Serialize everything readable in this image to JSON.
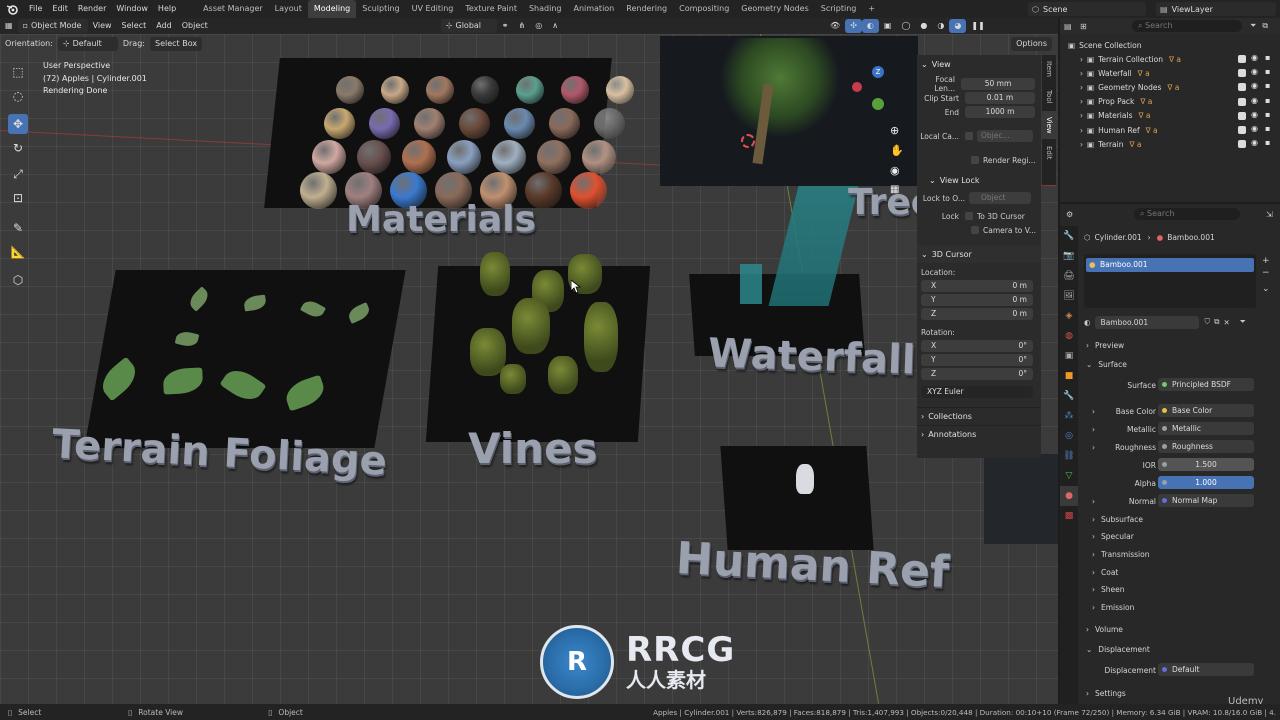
{
  "menu": {
    "items": [
      "File",
      "Edit",
      "Render",
      "Window",
      "Help"
    ],
    "workspaces": [
      "Asset Manager",
      "Layout",
      "Modeling",
      "Sculpting",
      "UV Editing",
      "Texture Paint",
      "Shading",
      "Animation",
      "Rendering",
      "Compositing",
      "Geometry Nodes",
      "Scripting"
    ],
    "active_workspace": "Modeling",
    "add_tab": "+",
    "scene": "Scene",
    "view_layer": "ViewLayer"
  },
  "viewport_header": {
    "mode": "Object Mode",
    "menus": [
      "View",
      "Select",
      "Add",
      "Object"
    ],
    "transform": "Global",
    "options": "Options",
    "orientation_label": "Orientation:",
    "orientation": "Default",
    "drag_label": "Drag:",
    "drag": "Select Box"
  },
  "viewport_info": {
    "perspective": "User Perspective",
    "object": "(72) Apples | Cylinder.001",
    "status": "Rendering Done"
  },
  "viewport_labels": {
    "materials": "Materials",
    "terrain_foliage": "Terrain Foliage",
    "vines": "Vines",
    "waterfall": "Waterfall",
    "human_ref": "Human Ref",
    "trees": "Tree"
  },
  "npanel": {
    "view_header": "View",
    "focal_label": "Focal Len...",
    "focal_value": "50 mm",
    "clip_start_label": "Clip Start",
    "clip_start_value": "0.01 m",
    "clip_end_label": "End",
    "clip_end_value": "1000 m",
    "local_camera_label": "Local Ca...",
    "local_camera_placeholder": "Objec...",
    "render_region": "Render Regi...",
    "view_lock_header": "View Lock",
    "lock_to_object_label": "Lock to O...",
    "lock_to_object_placeholder": "Object",
    "lock_label": "Lock",
    "to_3d_cursor": "To 3D Cursor",
    "camera_to_view": "Camera to V...",
    "cursor_header": "3D Cursor",
    "location_label": "Location:",
    "loc_x_label": "X",
    "loc_x": "0 m",
    "loc_y_label": "Y",
    "loc_y": "0 m",
    "loc_z_label": "Z",
    "loc_z": "0 m",
    "rotation_label": "Rotation:",
    "rot_x_label": "X",
    "rot_x": "0°",
    "rot_y_label": "Y",
    "rot_y": "0°",
    "rot_z_label": "Z",
    "rot_z": "0°",
    "rotation_mode": "XYZ Euler",
    "collections": "Collections",
    "annotations": "Annotations",
    "tabs": [
      "Item",
      "Tool",
      "View",
      "Edit"
    ]
  },
  "outliner": {
    "search_placeholder": "Search",
    "root": "Scene Collection",
    "items": [
      "Terrain Collection",
      "Waterfall",
      "Geometry Nodes",
      "Prop Pack",
      "Materials",
      "Human Ref",
      "Terrain"
    ]
  },
  "properties": {
    "search_placeholder": "Search",
    "breadcrumb_object": "Cylinder.001",
    "breadcrumb_material": "Bamboo.001",
    "slot": "Bamboo.001",
    "material_name": "Bamboo.001",
    "preview": "Preview",
    "surface_header": "Surface",
    "surface_label": "Surface",
    "surface_value": "Principled BSDF",
    "base_color_label": "Base Color",
    "base_color_value": "Base Color",
    "metallic_label": "Metallic",
    "metallic_value": "Metallic",
    "roughness_label": "Roughness",
    "roughness_value": "Roughness",
    "ior_label": "IOR",
    "ior_value": "1.500",
    "alpha_label": "Alpha",
    "alpha_value": "1.000",
    "normal_label": "Normal",
    "normal_value": "Normal Map",
    "collapsed": [
      "Subsurface",
      "Specular",
      "Transmission",
      "Coat",
      "Sheen",
      "Emission"
    ],
    "volume": "Volume",
    "displacement_header": "Displacement",
    "displacement_label": "Displacement",
    "displacement_value": "Default",
    "settings": "Settings"
  },
  "statusbar": {
    "select": "Select",
    "rotate": "Rotate View",
    "object": "Object",
    "stats": "Apples | Cylinder.001 | Verts:826,879 | Faces:818,879 | Tris:1,407,993 | Objects:0/20,448 | Duration: 00:10+10 (Frame 72/250) | Memory: 6.34 GiB | VRAM: 10.8/16.0 GiB | 4."
  },
  "watermark": {
    "brand": "RRCG",
    "subtitle": "人人素材",
    "udemy": "Udemy"
  },
  "colors": {
    "accent": "#4772b3",
    "ior_fill": "#545454",
    "alpha_fill": "#4772b3"
  }
}
